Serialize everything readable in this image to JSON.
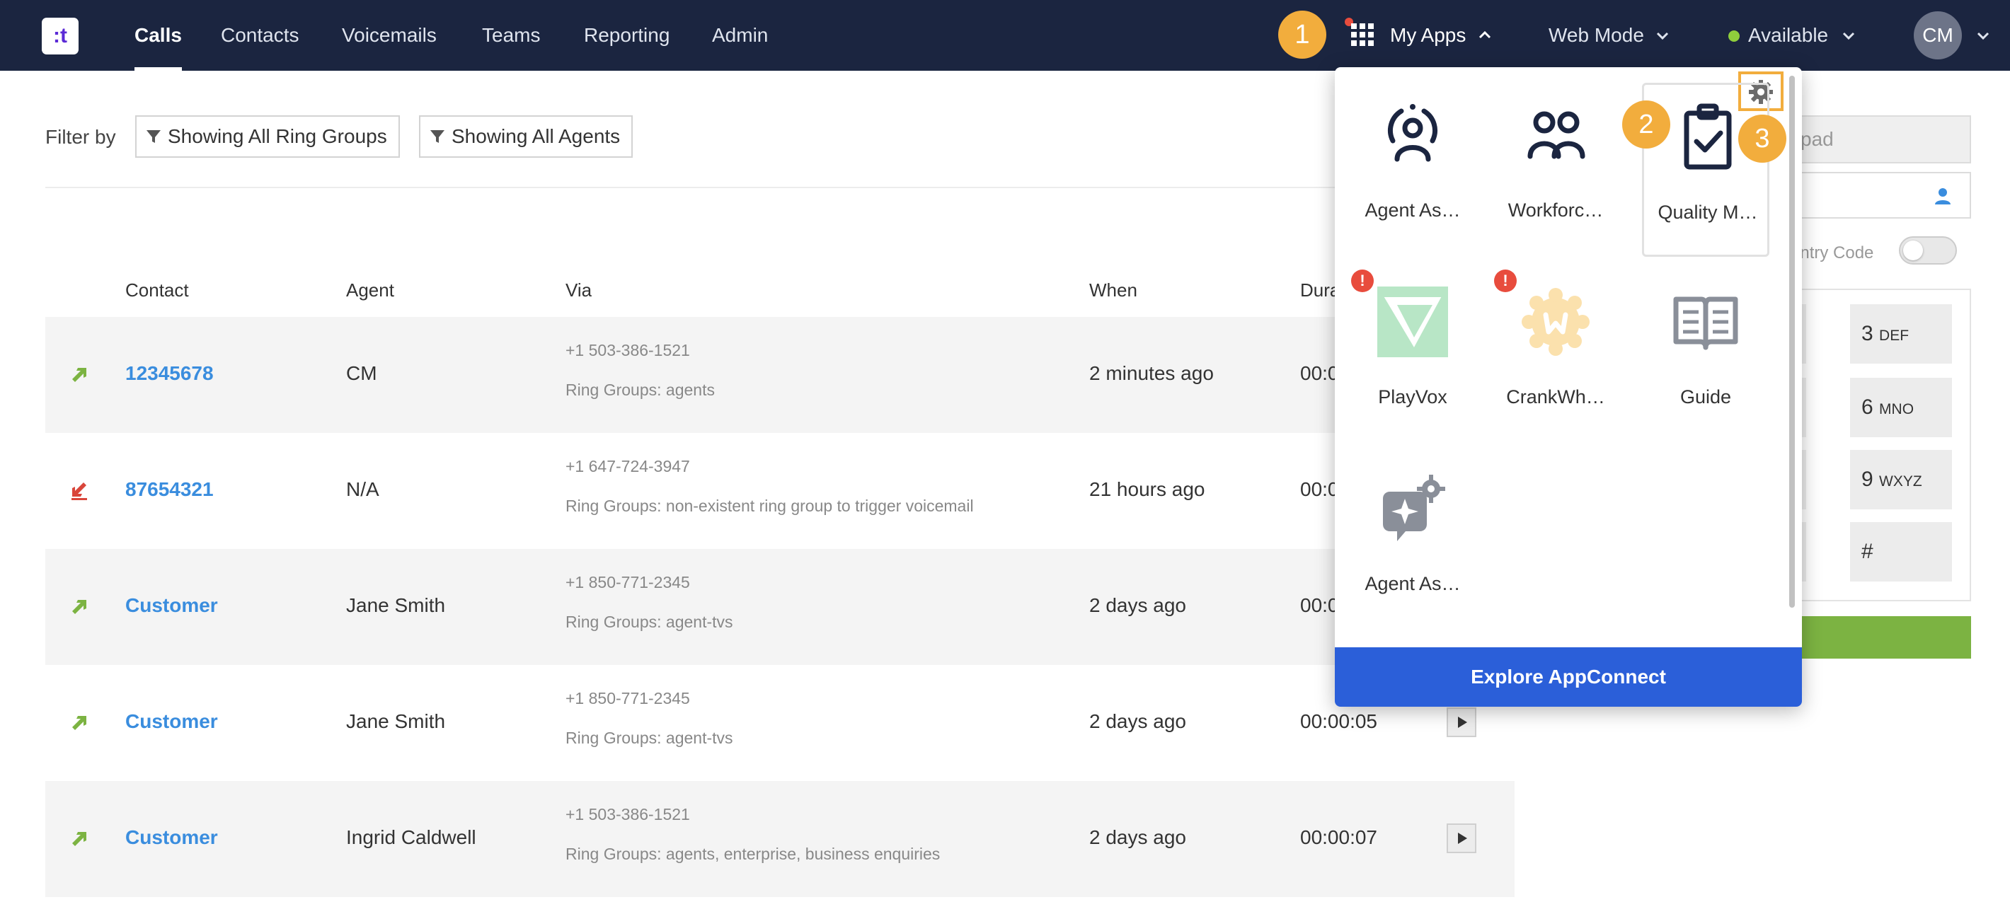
{
  "app": {
    "logo_text": ":t",
    "nav": {
      "items": [
        {
          "label": "Calls",
          "active": true
        },
        {
          "label": "Contacts"
        },
        {
          "label": "Voicemails"
        },
        {
          "label": "Teams"
        },
        {
          "label": "Reporting"
        },
        {
          "label": "Admin"
        }
      ],
      "my_apps_label": "My Apps",
      "mode_label": "Web Mode",
      "status_label": "Available",
      "avatar_initials": "CM"
    }
  },
  "callouts": [
    "1",
    "2",
    "3"
  ],
  "filters": {
    "label": "Filter by",
    "ring_groups": "Showing All Ring Groups",
    "agents": "Showing All Agents"
  },
  "table": {
    "columns": [
      "Contact",
      "Agent",
      "Via",
      "When",
      "Dura"
    ],
    "rows": [
      {
        "direction": "outbound",
        "contact": "12345678",
        "agent": "CM",
        "via_number": "+1 503-386-1521",
        "via_ring_groups": "Ring Groups: agents",
        "when": "2 minutes ago",
        "duration": "00:0"
      },
      {
        "direction": "missed",
        "contact": "87654321",
        "agent": "N/A",
        "via_number": "+1 647-724-3947",
        "via_ring_groups": "Ring Groups: non-existent ring group to trigger voicemail",
        "when": "21 hours ago",
        "duration": "00:0"
      },
      {
        "direction": "outbound",
        "contact": "Customer",
        "agent": "Jane Smith",
        "via_number": "+1 850-771-2345",
        "via_ring_groups": "Ring Groups: agent-tvs",
        "when": "2 days ago",
        "duration": "00:0"
      },
      {
        "direction": "outbound",
        "contact": "Customer",
        "agent": "Jane Smith",
        "via_number": "+1 850-771-2345",
        "via_ring_groups": "Ring Groups: agent-tvs",
        "when": "2 days ago",
        "duration": "00:00:05"
      },
      {
        "direction": "outbound",
        "contact": "Customer",
        "agent": "Ingrid Caldwell",
        "via_number": "+1 503-386-1521",
        "via_ring_groups": "Ring Groups: agents, enterprise, business enquiries",
        "when": "2 days ago",
        "duration": "00:00:07"
      }
    ]
  },
  "dialer": {
    "keypad_placeholder": "ypad",
    "country_code_label": "untry Code",
    "keys": [
      {
        "digit": "3",
        "letters": "DEF"
      },
      {
        "digit": "6",
        "letters": "MNO"
      },
      {
        "digit": "9",
        "letters": "WXYZ"
      },
      {
        "digit": "#",
        "letters": ""
      }
    ]
  },
  "apps_menu": {
    "apps": [
      {
        "label": "Agent As…",
        "icon": "agent-assist-icon"
      },
      {
        "label": "Workforc…",
        "icon": "workforce-icon"
      },
      {
        "label": "Quality M…",
        "icon": "quality-management-icon",
        "selected": true
      },
      {
        "label": "PlayVox",
        "icon": "playvox-icon",
        "warning": true
      },
      {
        "label": "CrankWh…",
        "icon": "crankwheel-icon",
        "warning": true
      },
      {
        "label": "Guide",
        "icon": "guide-book-icon"
      },
      {
        "label": "Agent As…",
        "icon": "agent-assist-settings-icon"
      }
    ],
    "warning_glyph": "!",
    "explore_label": "Explore AppConnect"
  },
  "colors": {
    "nav_bg": "#1b2540",
    "callout": "#f2ad3d",
    "link": "#3a8dde",
    "explore_bg": "#2b5fd9",
    "outbound_arrow": "#7cb342",
    "missed_arrow": "#d9463b",
    "available_dot": "#8fce3c"
  }
}
